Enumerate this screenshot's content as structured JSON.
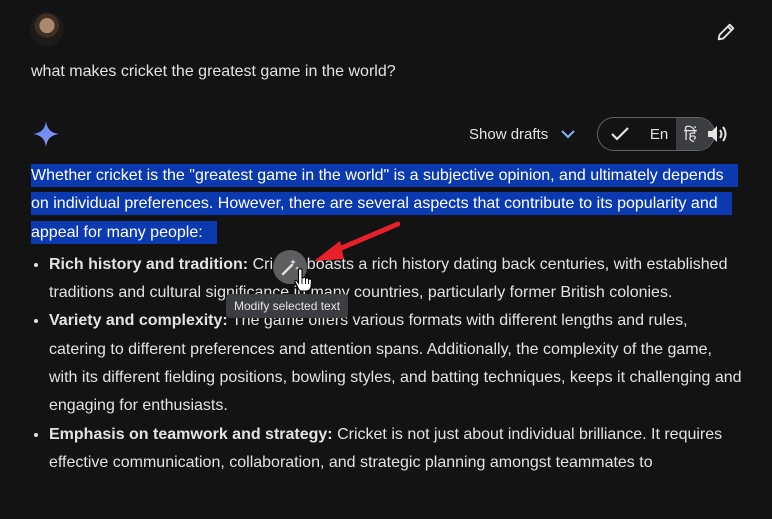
{
  "user_prompt": "what makes cricket the greatest game in the world?",
  "toolbar": {
    "show_drafts_label": "Show drafts",
    "lang_english": "En",
    "lang_hindi": "हिं"
  },
  "response": {
    "intro": "Whether cricket is the \"greatest game in the world\" is a subjective opinion, and ultimately depends on individual preferences. However, there are several aspects that contribute to its popularity and appeal for many people:",
    "points": [
      {
        "title": "Rich history and tradition:",
        "text": " Cricket boasts a rich history dating back centuries, with established traditions and cultural significance in many countries, particularly former British colonies."
      },
      {
        "title": "Variety and complexity:",
        "text": " The game offers various formats with different lengths and rules, catering to different preferences and attention spans. Additionally, the complexity of the game, with its different fielding positions, bowling styles, and batting techniques, keeps it challenging and engaging for enthusiasts."
      },
      {
        "title": "Emphasis on teamwork and strategy:",
        "text": " Cricket is not just about individual brilliance. It requires effective communication, collaboration, and strategic planning amongst teammates to"
      }
    ]
  },
  "floating_action": {
    "tooltip": "Modify selected text",
    "icon": "magic-pen-icon"
  },
  "colors": {
    "background": "#131314",
    "selection": "#0b3ab0",
    "annotation_arrow": "#e8202a",
    "gemini_spark": "#6a9cf5"
  }
}
